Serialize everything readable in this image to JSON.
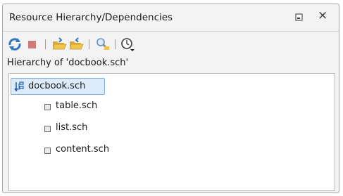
{
  "panel": {
    "title": "Resource Hierarchy/Dependencies",
    "close_glyph": "×"
  },
  "toolbar": {
    "buttons": [
      {
        "name": "refresh-icon"
      },
      {
        "name": "stop-icon",
        "color": "#d2797b"
      },
      {
        "name": "open-folder-icon"
      },
      {
        "name": "open-folder-alt-icon"
      },
      {
        "name": "search-references-icon"
      },
      {
        "name": "history-dropdown-icon"
      }
    ]
  },
  "hierarchy": {
    "label": "Hierarchy of 'docbook.sch'",
    "root": "docbook.sch",
    "children": [
      "table.sch",
      "list.sch",
      "content.sch"
    ]
  },
  "colors": {
    "selection_bg": "#dcebfb",
    "selection_border": "#7eb4ea",
    "accent_blue": "#2f79c2",
    "folder_yellow": "#f0c44c"
  }
}
